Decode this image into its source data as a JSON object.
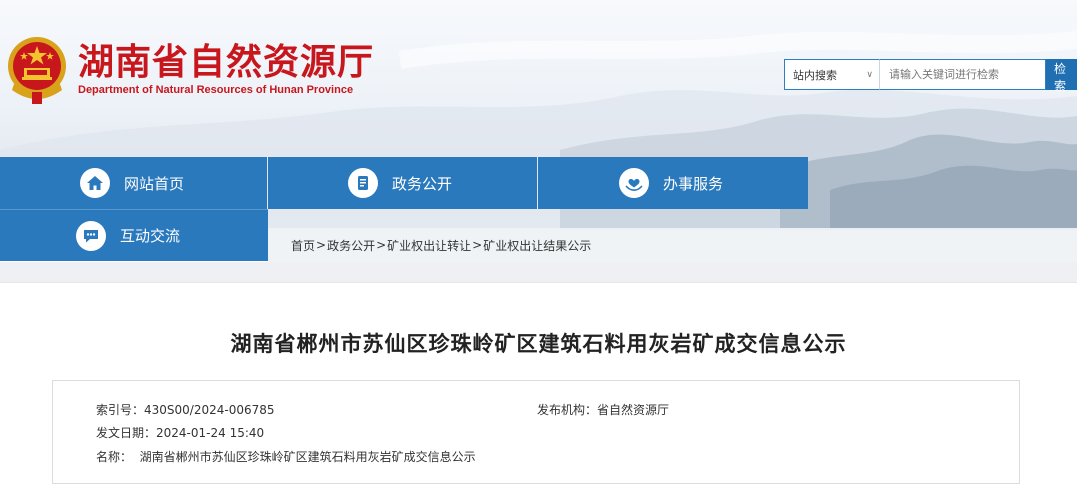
{
  "site": {
    "title": "湖南省自然资源厅",
    "subtitle": "Department of Natural Resources of Hunan Province"
  },
  "search": {
    "scope": "站内搜索",
    "placeholder": "请输入关键词进行检索",
    "button": "检 索"
  },
  "nav": [
    {
      "label": "网站首页",
      "icon": "home-icon"
    },
    {
      "label": "政务公开",
      "icon": "document-icon"
    },
    {
      "label": "办事服务",
      "icon": "heart-hand-icon"
    },
    {
      "label": "互动交流",
      "icon": "chat-icon"
    }
  ],
  "breadcrumb": [
    "首页",
    "政务公开",
    "矿业权出让转让",
    "矿业权出让结果公示"
  ],
  "article": {
    "title": "湖南省郴州市苏仙区珍珠岭矿区建筑石料用灰岩矿成交信息公示",
    "index_label": "索引号：",
    "index_value": "430S00/2024-006785",
    "org_label": "发布机构：",
    "org_value": "省自然资源厅",
    "date_label": "发文日期：",
    "date_value": "2024-01-24 15:40",
    "name_label": "名称：",
    "name_value": "湖南省郴州市苏仙区珍珠岭矿区建筑石料用灰岩矿成交信息公示"
  },
  "colors": {
    "brand_red": "#c8161d",
    "nav_blue": "#2a79bd",
    "search_blue": "#1f6fb2"
  }
}
